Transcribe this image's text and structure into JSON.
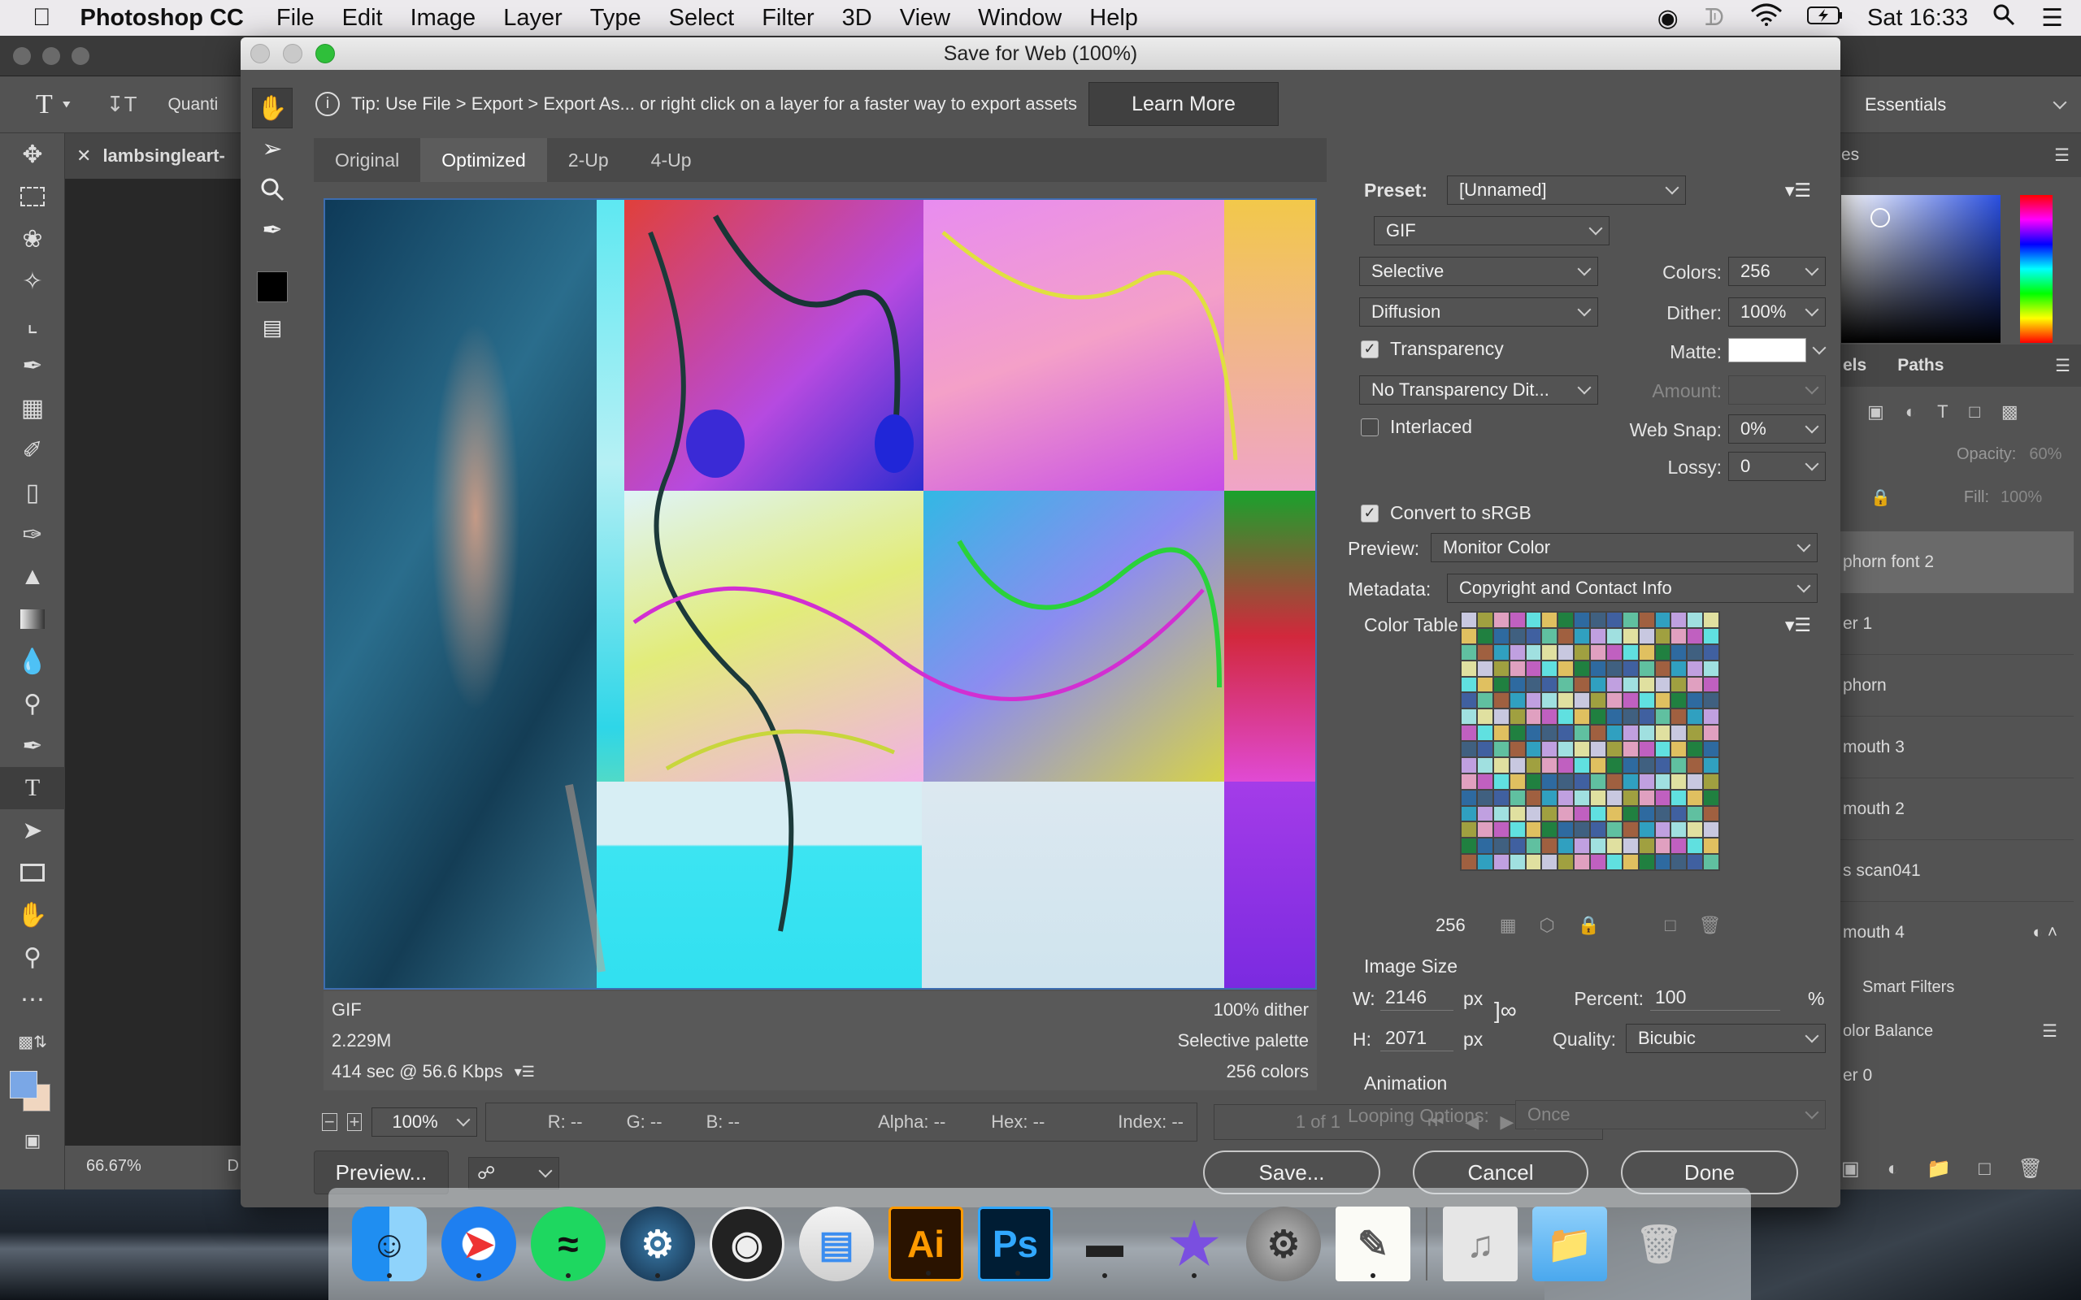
{
  "menubar": {
    "apple": "",
    "app": "Photoshop CC",
    "items": [
      "File",
      "Edit",
      "Image",
      "Layer",
      "Type",
      "Select",
      "Filter",
      "3D",
      "View",
      "Window",
      "Help"
    ],
    "clock": "Sat 16:33"
  },
  "ps": {
    "options_font_field": "Quanti",
    "doc_tab": "lambsingleart-",
    "workspace": "Essentials",
    "zoom_status": "66.67%",
    "status_suffix": "D",
    "panels": {
      "tab_channels": "els",
      "tab_paths": "Paths",
      "top_tab": "es",
      "opacity_label": "Opacity:",
      "opacity_value": "60%",
      "fill_label": "Fill:",
      "fill_value": "100%",
      "layers": [
        "phorn font 2",
        "er 1",
        "phorn",
        "mouth 3",
        "mouth 2",
        "s scan041",
        "mouth 4",
        "Smart Filters",
        "olor Balance",
        "er 0"
      ]
    }
  },
  "dialog": {
    "title": "Save for Web (100%)",
    "tip": "Tip: Use File > Export > Export As...  or right click on a layer for a faster way to export assets",
    "learn_more": "Learn More",
    "tabs": [
      "Original",
      "Optimized",
      "2-Up",
      "4-Up"
    ],
    "info_left": [
      "GIF",
      "2.229M",
      "414 sec @ 56.6 Kbps"
    ],
    "info_right": [
      "100% dither",
      "Selective palette",
      "256 colors"
    ],
    "zoom": "100%",
    "readouts": {
      "r": "R: --",
      "g": "G: --",
      "b": "B: --",
      "alpha": "Alpha: --",
      "hex": "Hex: --",
      "index": "Index: --"
    },
    "preview_btn": "Preview...",
    "save_btn": "Save...",
    "cancel_btn": "Cancel",
    "done_btn": "Done"
  },
  "settings": {
    "preset_label": "Preset:",
    "preset_value": "[Unnamed]",
    "format": "GIF",
    "reduction": "Selective",
    "colors_label": "Colors:",
    "colors_value": "256",
    "dither_algo": "Diffusion",
    "dither_label": "Dither:",
    "dither_value": "100%",
    "transparency_label": "Transparency",
    "transparency_checked": true,
    "matte_label": "Matte:",
    "trans_dither": "No Transparency Dit...",
    "amount_label": "Amount:",
    "interlaced_label": "Interlaced",
    "interlaced_checked": false,
    "websnap_label": "Web Snap:",
    "websnap_value": "0%",
    "lossy_label": "Lossy:",
    "lossy_value": "0",
    "srgb_label": "Convert to sRGB",
    "srgb_checked": true,
    "preview_label": "Preview:",
    "preview_value": "Monitor Color",
    "metadata_label": "Metadata:",
    "metadata_value": "Copyright and Contact Info",
    "color_table_label": "Color Table",
    "color_count": "256",
    "image_size_label": "Image Size",
    "w_label": "W:",
    "w_value": "2146",
    "h_label": "H:",
    "h_value": "2071",
    "px": "px",
    "percent_label": "Percent:",
    "percent_value": "100",
    "percent_unit": "%",
    "quality_label": "Quality:",
    "quality_value": "Bicubic",
    "animation_label": "Animation",
    "looping_label": "Looping Options:",
    "looping_value": "Once",
    "frame_counter": "1 of 1"
  },
  "dock": {
    "apps": [
      "finder-icon",
      "safari-icon",
      "spotify-icon",
      "steam-icon",
      "obs-icon",
      "preview-icon",
      "illustrator-icon",
      "photoshop-icon",
      "scanner-icon",
      "imovie-icon",
      "system-preferences-icon",
      "textedit-icon",
      "music-folder-icon",
      "folder-icon",
      "trash-icon"
    ],
    "ai_text": "Ai",
    "ps_text": "Ps"
  },
  "colors": {
    "accent": "#3d6db0",
    "ps_bg": "#535353",
    "dialog_bg": "#535353"
  }
}
